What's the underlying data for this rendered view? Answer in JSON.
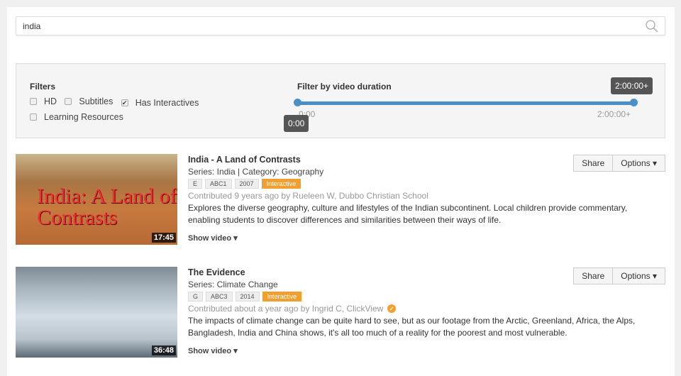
{
  "search": {
    "value": "india"
  },
  "filters": {
    "title": "Filters",
    "checkboxes": [
      {
        "label": "HD",
        "checked": false
      },
      {
        "label": "Subtitles",
        "checked": false
      },
      {
        "label": "Has Interactives",
        "checked": true
      },
      {
        "label": "Learning Resources",
        "checked": false
      }
    ],
    "duration": {
      "title": "Filter by video duration",
      "min_label": "0:00",
      "max_label": "2:00:00+",
      "low_tip": "0:00",
      "high_tip": "2:00:00+"
    }
  },
  "accent": "#4a90c8",
  "results": [
    {
      "title": "India - A Land of Contrasts",
      "series": "Series: India | Category: Geography",
      "tags": [
        "E",
        "ABC1",
        "2007"
      ],
      "badge": "Interactive",
      "contributed": "Contributed 9 years ago by Rueleen W, Dubbo Christian School",
      "description": "Explores the diverse geography, culture and lifestyles of the Indian subcontinent. Local children provide commentary, enabling students to discover differences and similarities between their ways of life.",
      "duration": "17:45",
      "thumb_text": "India: A Land of Contrasts",
      "show": "Show video",
      "share": "Share",
      "options": "Options"
    },
    {
      "title": "The Evidence",
      "series": "Series: Climate Change",
      "tags": [
        "G",
        "ABC3",
        "2014"
      ],
      "badge": "Interactive",
      "contributed": "Contributed about a year ago by Ingrid C, ClickView",
      "description": "The impacts of climate change can be quite hard to see, but as our footage from the Arctic, Greenland, Africa, the Alps, Bangladesh, India and China shows, it's all too much of a reality for the poorest and most vulnerable.",
      "duration": "36:48",
      "show": "Show video",
      "share": "Share",
      "options": "Options"
    }
  ]
}
